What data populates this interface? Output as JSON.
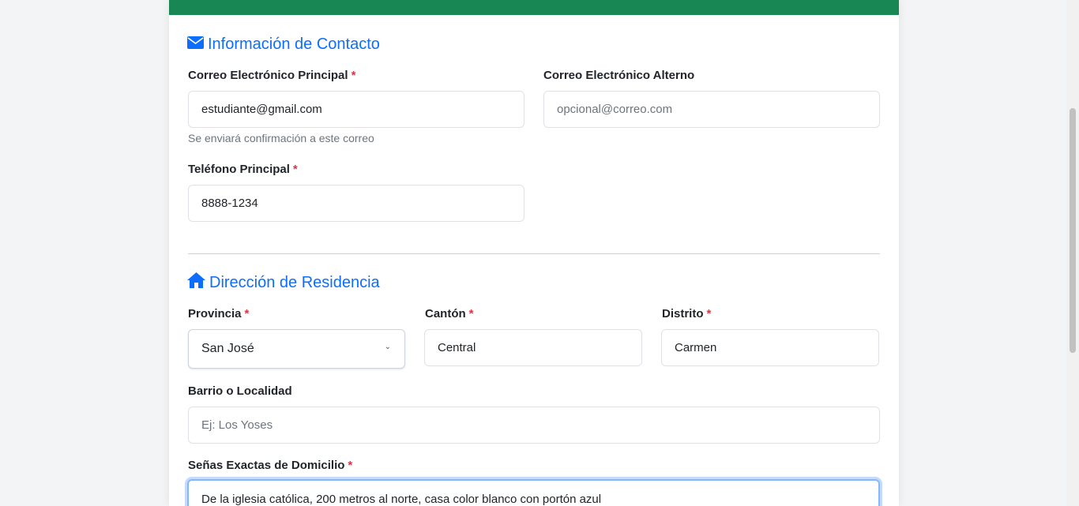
{
  "contact": {
    "title": "Información de Contacto",
    "email_primary": {
      "label": "Correo Electrónico Principal",
      "required": "*",
      "value": "estudiante@gmail.com",
      "help": "Se enviará confirmación a este correo"
    },
    "email_alt": {
      "label": "Correo Electrónico Alterno",
      "placeholder": "opcional@correo.com"
    },
    "phone": {
      "label": "Teléfono Principal",
      "required": "*",
      "value": "8888-1234"
    }
  },
  "address": {
    "title": "Dirección de Residencia",
    "province": {
      "label": "Provincia",
      "required": "*",
      "value": "San José"
    },
    "canton": {
      "label": "Cantón",
      "required": "*",
      "value": "Central"
    },
    "district": {
      "label": "Distrito",
      "required": "*",
      "value": "Carmen"
    },
    "neighborhood": {
      "label": "Barrio o Localidad",
      "placeholder": "Ej: Los Yoses"
    },
    "exact": {
      "label": "Señas Exactas de Domicilio",
      "required": "*",
      "value": "De la iglesia católica, 200 metros al norte, casa color blanco con portón azul"
    }
  },
  "colors": {
    "header_bar": "#198754",
    "accent": "#0d6efd",
    "required": "#dc3545"
  },
  "icons": {
    "contact": "envelope-icon",
    "address": "home-icon",
    "select": "chevron-down-icon"
  }
}
